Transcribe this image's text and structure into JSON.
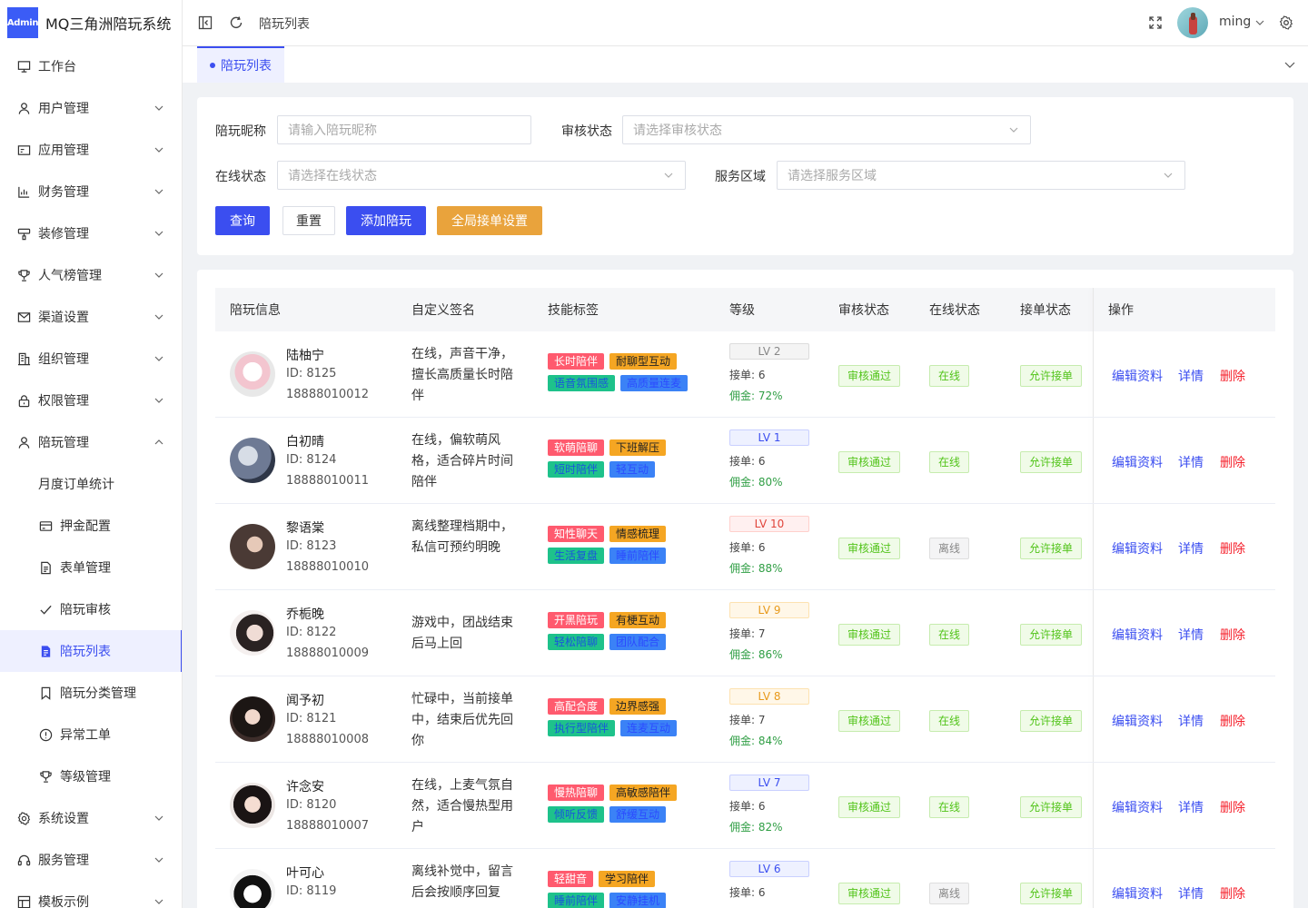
{
  "app": {
    "logo_badge": "Admin",
    "title": "MQ三角洲陪玩系统"
  },
  "topbar": {
    "breadcrumb": "陪玩列表",
    "user": "ming"
  },
  "tabs": [
    {
      "label": "陪玩列表"
    }
  ],
  "sidebar": {
    "items": [
      {
        "label": "工作台",
        "icon": "monitor-icon"
      },
      {
        "label": "用户管理",
        "icon": "user-icon"
      },
      {
        "label": "应用管理",
        "icon": "app-icon"
      },
      {
        "label": "财务管理",
        "icon": "chart-icon"
      },
      {
        "label": "装修管理",
        "icon": "paint-icon"
      },
      {
        "label": "人气榜管理",
        "icon": "trophy-icon"
      },
      {
        "label": "渠道设置",
        "icon": "mail-icon"
      },
      {
        "label": "组织管理",
        "icon": "building-icon"
      },
      {
        "label": "权限管理",
        "icon": "lock-icon"
      },
      {
        "label": "陪玩管理",
        "icon": "user-icon"
      },
      {
        "label": "月度订单统计",
        "icon": ""
      },
      {
        "label": "押金配置",
        "icon": "card-icon"
      },
      {
        "label": "表单管理",
        "icon": "document-icon"
      },
      {
        "label": "陪玩审核",
        "icon": "check-icon"
      },
      {
        "label": "陪玩列表",
        "icon": "list-icon"
      },
      {
        "label": "陪玩分类管理",
        "icon": "bookmark-icon"
      },
      {
        "label": "异常工单",
        "icon": "alert-icon"
      },
      {
        "label": "等级管理",
        "icon": "trophy-icon"
      },
      {
        "label": "系统设置",
        "icon": "gear-icon"
      },
      {
        "label": "服务管理",
        "icon": "headset-icon"
      },
      {
        "label": "模板示例",
        "icon": "layout-icon"
      }
    ]
  },
  "filters": {
    "nickname_label": "陪玩昵称",
    "nickname_placeholder": "请输入陪玩昵称",
    "review_label": "审核状态",
    "review_placeholder": "请选择审核状态",
    "online_label": "在线状态",
    "online_placeholder": "请选择在线状态",
    "area_label": "服务区域",
    "area_placeholder": "请选择服务区域",
    "query": "查询",
    "reset": "重置",
    "add": "添加陪玩",
    "global": "全局接单设置"
  },
  "table": {
    "headers": [
      "陪玩信息",
      "自定义签名",
      "技能标签",
      "等级",
      "审核状态",
      "在线状态",
      "接单状态",
      "操作"
    ],
    "actions": {
      "edit": "编辑资料",
      "detail": "详情",
      "delete": "删除"
    },
    "rows": [
      {
        "name": "陆柚宁",
        "id": "ID: 8125",
        "phone": "18888010012",
        "sig": "在线，声音干净，擅长高质量长时陪伴",
        "tags": [
          "长时陪伴",
          "耐聊型互动",
          "语音氛围感",
          "高质量连麦"
        ],
        "lv": "LV 2",
        "orders": "接单: 6",
        "comm": "佣金: 72%",
        "review": "审核通过",
        "online": "在线",
        "accept": "允许接单"
      },
      {
        "name": "白初晴",
        "id": "ID: 8124",
        "phone": "18888010011",
        "sig": "在线，偏软萌风格，适合碎片时间陪伴",
        "tags": [
          "软萌陪聊",
          "下班解压",
          "短时陪伴",
          "轻互动"
        ],
        "lv": "LV 1",
        "orders": "接单: 6",
        "comm": "佣金: 80%",
        "review": "审核通过",
        "online": "在线",
        "accept": "允许接单"
      },
      {
        "name": "黎语棠",
        "id": "ID: 8123",
        "phone": "18888010010",
        "sig": "离线整理档期中，私信可预约明晚",
        "tags": [
          "知性聊天",
          "情感梳理",
          "生活复盘",
          "睡前陪伴"
        ],
        "lv": "LV 10",
        "orders": "接单: 6",
        "comm": "佣金: 88%",
        "review": "审核通过",
        "online": "离线",
        "accept": "允许接单"
      },
      {
        "name": "乔栀晚",
        "id": "ID: 8122",
        "phone": "18888010009",
        "sig": "游戏中，团战结束后马上回",
        "tags": [
          "开黑陪玩",
          "有梗互动",
          "轻松陪聊",
          "团队配合"
        ],
        "lv": "LV 9",
        "orders": "接单: 7",
        "comm": "佣金: 86%",
        "review": "审核通过",
        "online": "在线",
        "accept": "允许接单"
      },
      {
        "name": "闻予初",
        "id": "ID: 8121",
        "phone": "18888010008",
        "sig": "忙碌中，当前接单中，结束后优先回你",
        "tags": [
          "高配合度",
          "边界感强",
          "执行型陪伴",
          "连麦互动"
        ],
        "lv": "LV 8",
        "orders": "接单: 7",
        "comm": "佣金: 84%",
        "review": "审核通过",
        "online": "在线",
        "accept": "允许接单"
      },
      {
        "name": "许念安",
        "id": "ID: 8120",
        "phone": "18888010007",
        "sig": "在线，上麦气氛自然，适合慢热型用户",
        "tags": [
          "慢热陪聊",
          "高敏感陪伴",
          "倾听反馈",
          "舒缓互动"
        ],
        "lv": "LV 7",
        "orders": "接单: 6",
        "comm": "佣金: 82%",
        "review": "审核通过",
        "online": "在线",
        "accept": "允许接单"
      },
      {
        "name": "叶可心",
        "id": "ID: 8119",
        "phone": "",
        "sig": "离线补觉中，留言后会按顺序回复",
        "tags": [
          "轻甜音",
          "学习陪伴",
          "睡前陪伴",
          "安静挂机"
        ],
        "lv": "LV 6",
        "orders": "接单: 6",
        "comm": "",
        "review": "审核通过",
        "online": "离线",
        "accept": "允许接单"
      }
    ]
  },
  "colors": {
    "primary": "#3b4ef0",
    "warning": "#f0a43a",
    "success": "#52c41a",
    "danger": "#f5222d"
  }
}
